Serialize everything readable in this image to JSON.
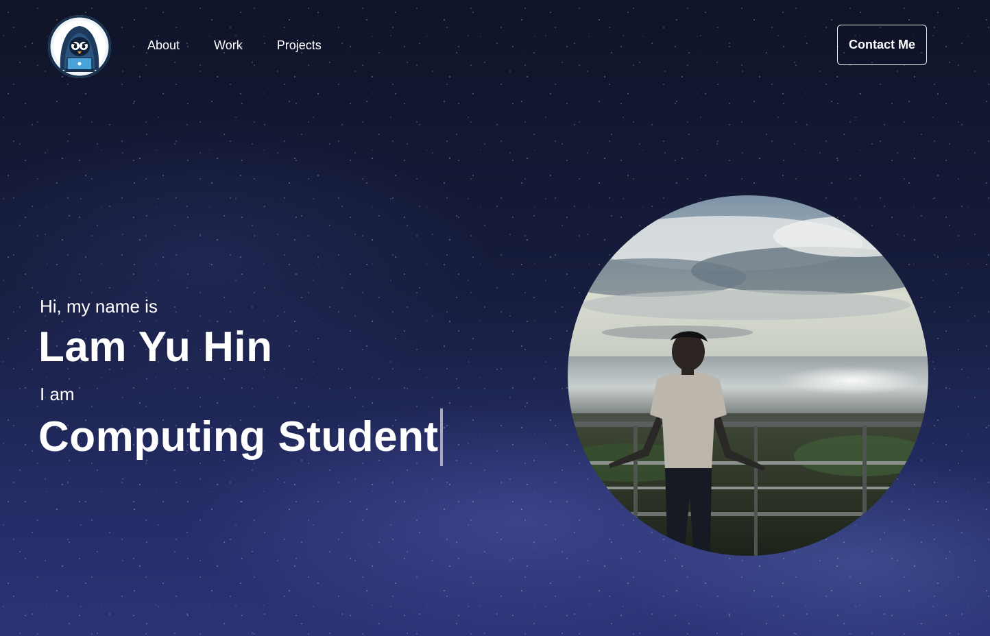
{
  "header": {
    "logo_name": "hooded-penguin-laptop-logo",
    "nav": [
      {
        "label": "About"
      },
      {
        "label": "Work"
      },
      {
        "label": "Projects"
      }
    ],
    "contact_label": "Contact Me"
  },
  "hero": {
    "greeting": "Hi, my name is",
    "name": "Lam Yu Hin",
    "intro": "I am",
    "role": "Computing Student"
  },
  "portrait": {
    "description_icon": "profile-photo"
  },
  "colors": {
    "background": "#161c3c",
    "text": "#ffffff",
    "button_border": "#ffffff"
  }
}
